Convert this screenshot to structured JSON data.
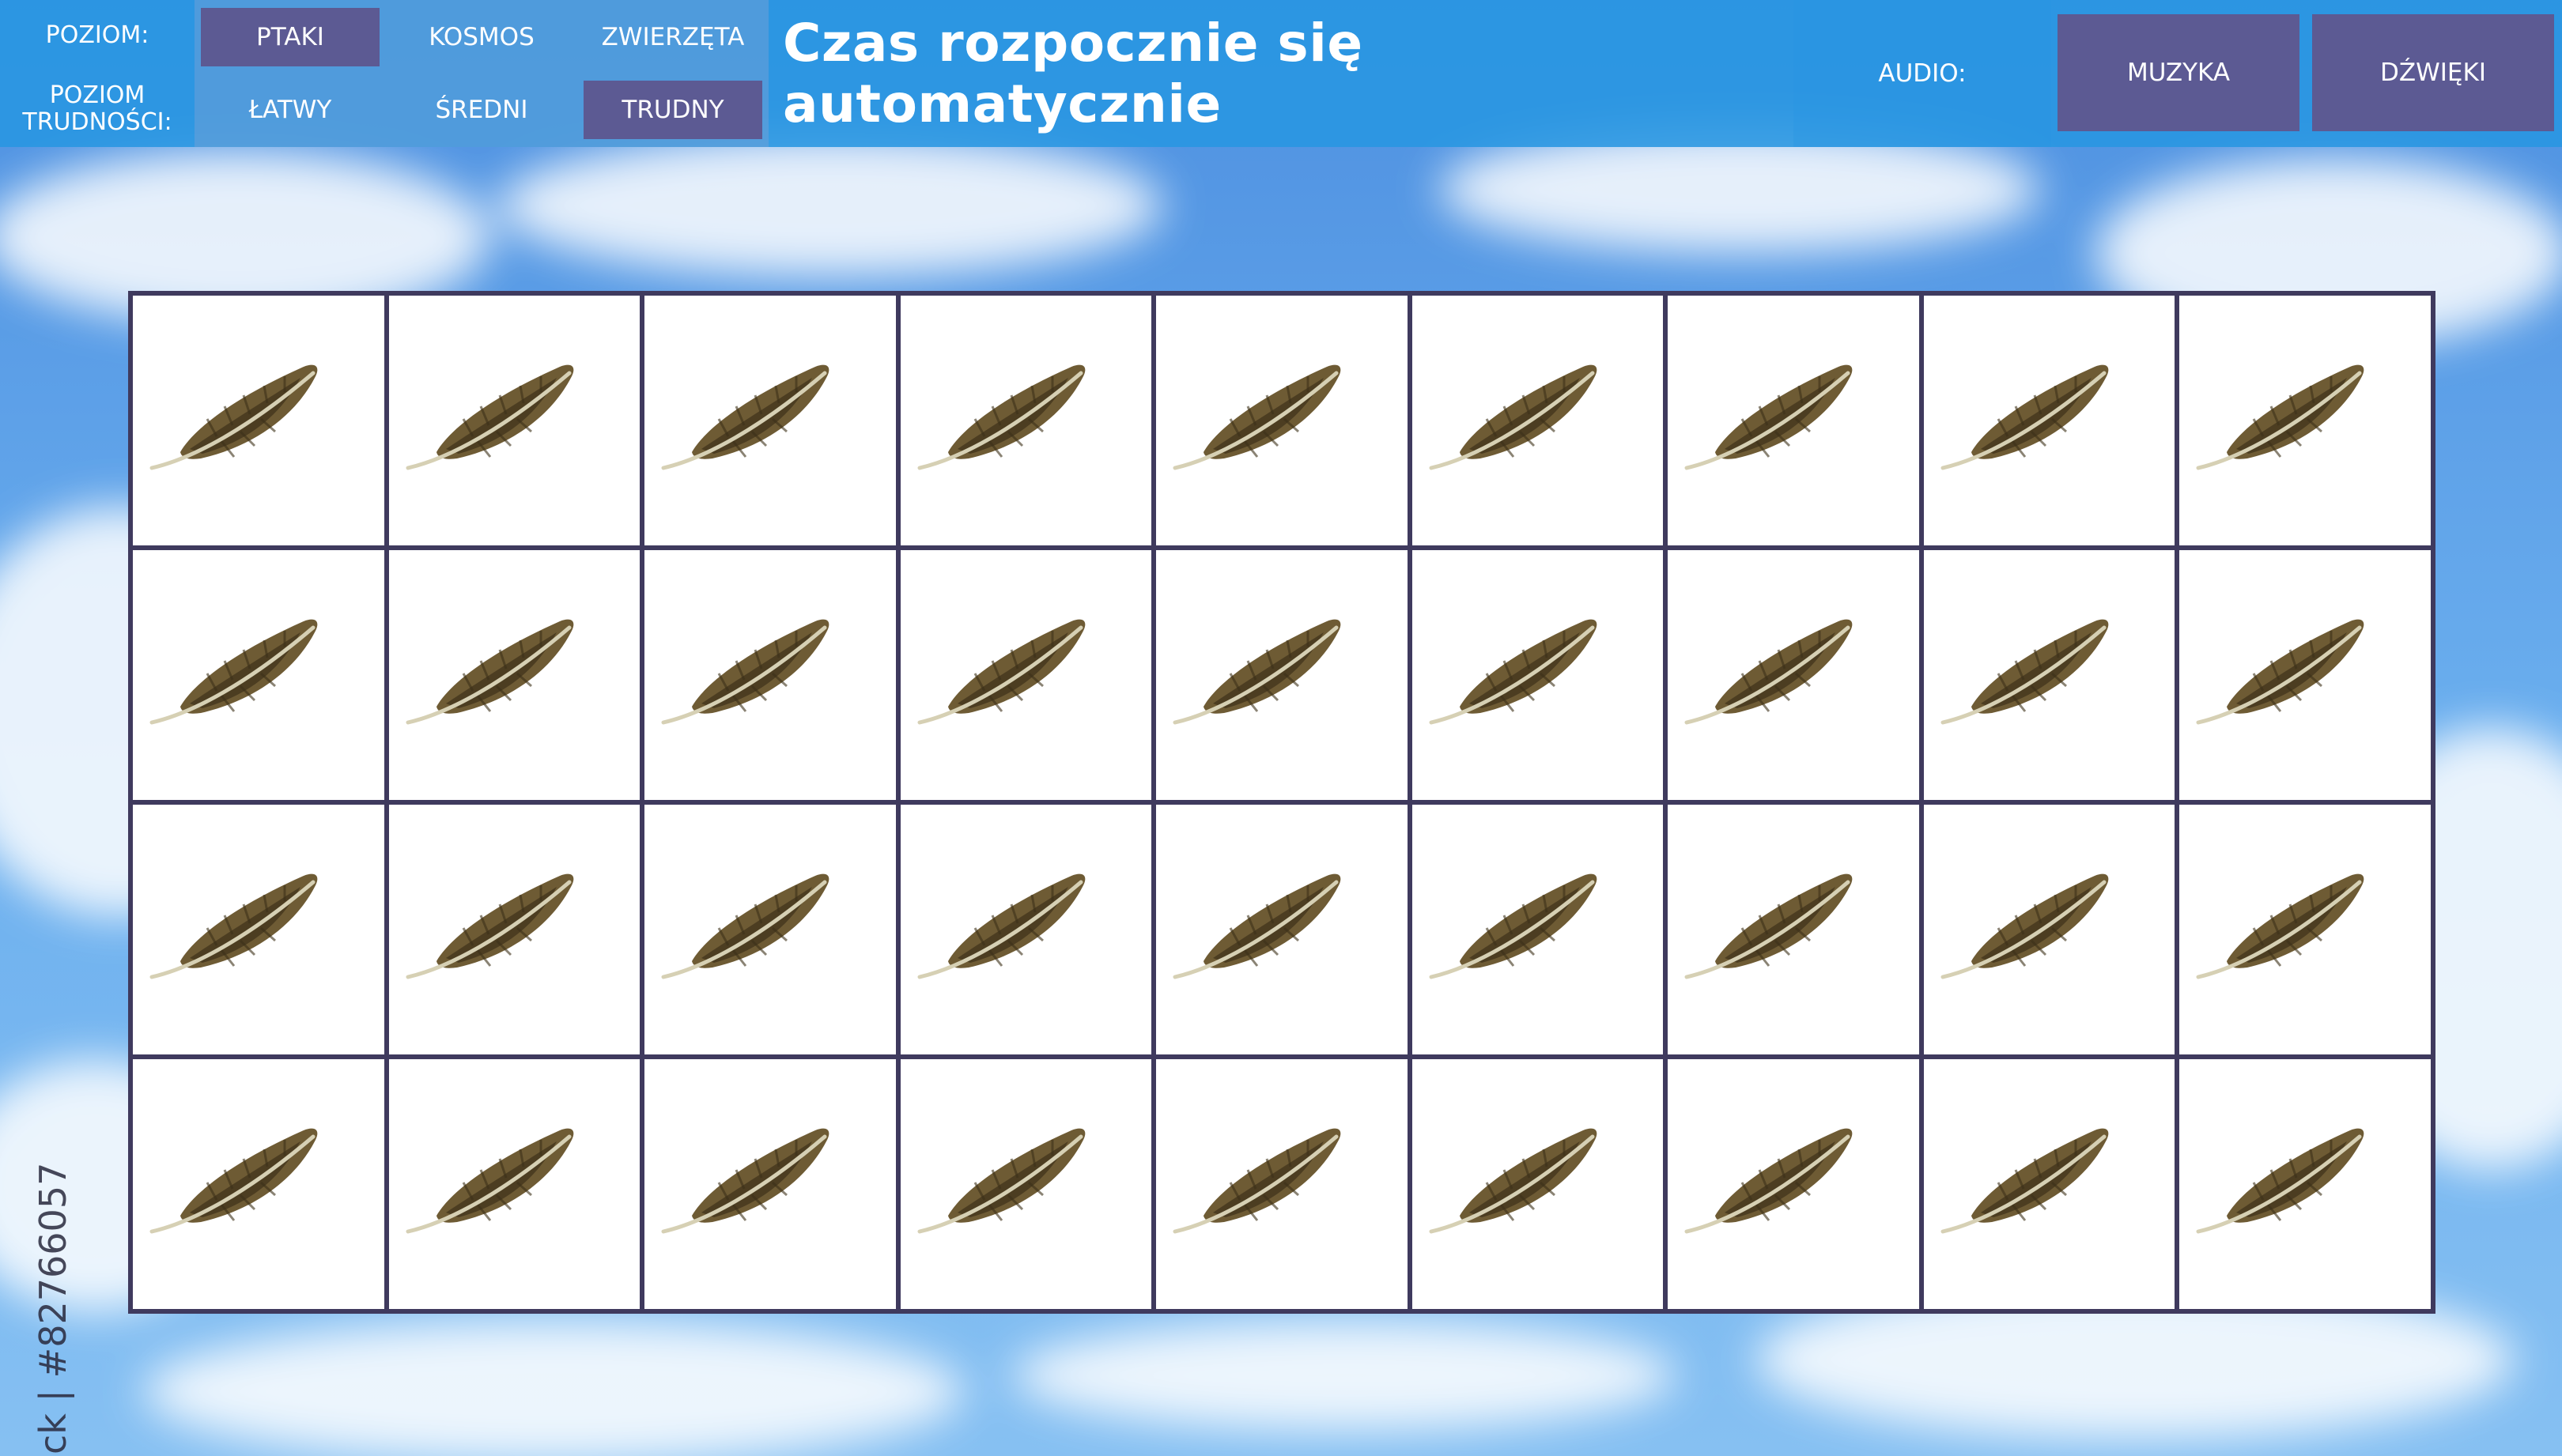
{
  "top_bar": {
    "level_label": "POZIOM:",
    "difficulty_label": "POZIOM\nTRUDNOŚCI:",
    "themes": [
      {
        "label": "PTAKI",
        "active": true
      },
      {
        "label": "KOSMOS",
        "active": false
      },
      {
        "label": "ZWIERZĘTA",
        "active": false
      }
    ],
    "difficulties": [
      {
        "label": "ŁATWY",
        "active": false
      },
      {
        "label": "ŚREDNI",
        "active": false
      },
      {
        "label": "TRUDNY",
        "active": true
      }
    ],
    "title": "Czas rozpocznie się automatycznie",
    "audio_label": "AUDIO:",
    "audio_buttons": [
      {
        "label": "MUZYKA"
      },
      {
        "label": "DŹWIĘKI"
      }
    ]
  },
  "board": {
    "rows": 4,
    "columns": 9,
    "card_back_icon": "feather-icon",
    "card_back_colors": {
      "vane": "#6e5b34",
      "vane_dark": "#3d3119",
      "shaft": "#d6d0b4"
    }
  },
  "watermark": {
    "text": "ck | #82766057"
  },
  "colors": {
    "top_bar": "#2896e1",
    "active_button": "#5c5a93",
    "card_border": "#3f3a5e"
  }
}
